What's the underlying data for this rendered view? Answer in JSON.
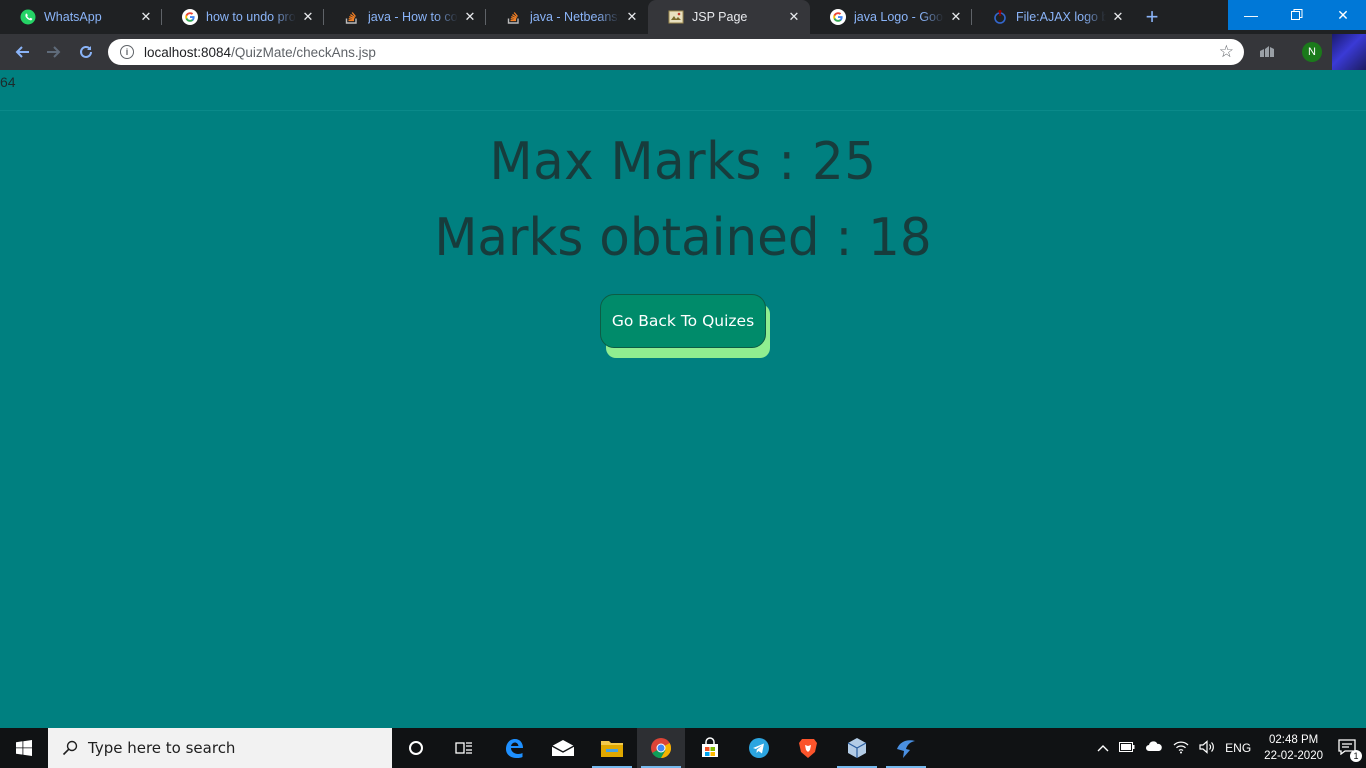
{
  "browser": {
    "tabs": [
      {
        "title": "WhatsApp",
        "icon": "whatsapp-icon"
      },
      {
        "title": "how to undo project",
        "icon": "google-icon"
      },
      {
        "title": "java - How to com",
        "icon": "stackoverflow-icon"
      },
      {
        "title": "java - Netbeans: h",
        "icon": "stackoverflow-icon"
      },
      {
        "title": "JSP Page",
        "icon": "page-icon"
      },
      {
        "title": "java Logo - Google",
        "icon": "google-icon"
      },
      {
        "title": "File:AJAX logo by g",
        "icon": "wikimedia-icon"
      }
    ],
    "active_tab_index": 4,
    "url_host": "localhost:8084",
    "url_path": "/QuizMate/checkAns.jsp",
    "profile_initial": "N"
  },
  "page": {
    "counter": "64",
    "max_marks": "Max Marks : 25",
    "marks_obtained": "Marks obtained : 18",
    "back_button": "Go Back To Quizes",
    "background_color": "#008080",
    "button_shadow_color": "#90ee90"
  },
  "taskbar": {
    "search_placeholder": "Type here to search",
    "language": "ENG",
    "time": "02:48 PM",
    "date": "22-02-2020",
    "notification_count": "1"
  }
}
